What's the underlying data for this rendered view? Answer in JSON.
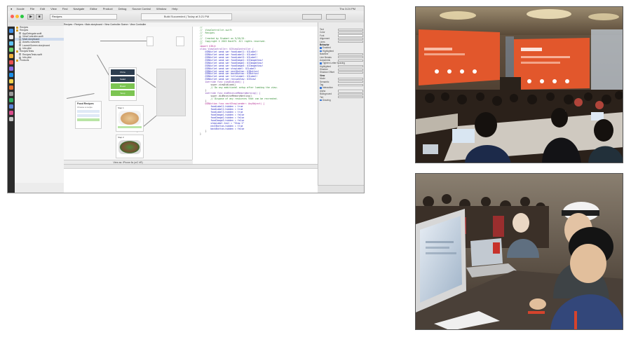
{
  "xcode": {
    "menu": [
      "Xcode",
      "File",
      "Edit",
      "View",
      "Find",
      "Navigate",
      "Editor",
      "Product",
      "Debug",
      "Source Control",
      "Window",
      "Help"
    ],
    "menu_right": "Thu 3:24 PM",
    "status_title": "Build Succeeded | Today at 3:21 PM",
    "scheme": "Recipes",
    "jump_path": "Recipes › Recipes › Main.storyboard › View Controller Scene › View Controller",
    "storyboard": {
      "buttons": [
        "Pizza",
        "Salad",
        "Bread",
        "Soup"
      ],
      "scene_title": "Food Recipes",
      "labels": [
        "Choose a recipe",
        "Step 1",
        "Step 2"
      ],
      "footer": "View as: iPhone 6s (wC hR)"
    },
    "code": [
      {
        "cls": "c",
        "text": "//"
      },
      {
        "cls": "c",
        "text": "//  ViewController.swift"
      },
      {
        "cls": "c",
        "text": "//  Recipes"
      },
      {
        "cls": "c",
        "text": "//"
      },
      {
        "cls": "c",
        "text": "//  Created by Student on 9/26/15."
      },
      {
        "cls": "c",
        "text": "//  Copyright © 2015 HackTX. All rights reserved."
      },
      {
        "cls": "c",
        "text": "//"
      },
      {
        "cls": "p",
        "text": ""
      },
      {
        "cls": "k",
        "text": "import UIKit"
      },
      {
        "cls": "p",
        "text": ""
      },
      {
        "cls": "t",
        "text": "class ViewController: UIViewController {"
      },
      {
        "cls": "p",
        "text": ""
      },
      {
        "cls": "n",
        "text": "    @IBOutlet weak var foodLabel1: UILabel!"
      },
      {
        "cls": "n",
        "text": "    @IBOutlet weak var foodLabel2: UILabel!"
      },
      {
        "cls": "n",
        "text": "    @IBOutlet weak var foodLabel3: UILabel!"
      },
      {
        "cls": "n",
        "text": "    @IBOutlet weak var foodImage1: UIImageView!"
      },
      {
        "cls": "n",
        "text": "    @IBOutlet weak var foodImage2: UIImageView!"
      },
      {
        "cls": "n",
        "text": "    @IBOutlet weak var foodImage3: UIImageView!"
      },
      {
        "cls": "n",
        "text": "    @IBOutlet weak var stepLabel: UILabel!"
      },
      {
        "cls": "n",
        "text": "    @IBOutlet weak var nextButton: UIButton!"
      },
      {
        "cls": "n",
        "text": "    @IBOutlet weak var backButton: UIButton!"
      },
      {
        "cls": "n",
        "text": "    @IBOutlet weak var titleLabel: UILabel!"
      },
      {
        "cls": "n",
        "text": "    @IBOutlet weak var recipeView: UIView!"
      },
      {
        "cls": "p",
        "text": ""
      },
      {
        "cls": "t",
        "text": "    override func viewDidLoad() {"
      },
      {
        "cls": "p",
        "text": "        super.viewDidLoad()"
      },
      {
        "cls": "c",
        "text": "        // Do any additional setup after loading the view."
      },
      {
        "cls": "p",
        "text": "    }"
      },
      {
        "cls": "p",
        "text": ""
      },
      {
        "cls": "t",
        "text": "    override func didReceiveMemoryWarning() {"
      },
      {
        "cls": "p",
        "text": "        super.didReceiveMemoryWarning()"
      },
      {
        "cls": "c",
        "text": "        // Dispose of any resources that can be recreated."
      },
      {
        "cls": "p",
        "text": "    }"
      },
      {
        "cls": "p",
        "text": ""
      },
      {
        "cls": "k",
        "text": "    @IBAction func nextStep(sender: AnyObject) {"
      },
      {
        "cls": "n",
        "text": "        foodLabel1.hidden = true"
      },
      {
        "cls": "n",
        "text": "        foodLabel2.hidden = true"
      },
      {
        "cls": "n",
        "text": "        foodLabel3.hidden = true"
      },
      {
        "cls": "n",
        "text": "        foodImage1.hidden = false"
      },
      {
        "cls": "n",
        "text": "        foodImage2.hidden = false"
      },
      {
        "cls": "n",
        "text": "        foodImage3.hidden = false"
      },
      {
        "cls": "n",
        "text": "        stepLabel.text = \"Step 2\""
      },
      {
        "cls": "n",
        "text": "        nextButton.hidden = true"
      },
      {
        "cls": "n",
        "text": "        backButton.hidden = false"
      },
      {
        "cls": "p",
        "text": "    }"
      },
      {
        "cls": "p",
        "text": "}"
      }
    ],
    "navigator": [
      {
        "label": "Recipes",
        "folder": true,
        "sel": false
      },
      {
        "label": "Recipes",
        "folder": true,
        "sel": false
      },
      {
        "label": "AppDelegate.swift",
        "folder": false,
        "sel": false
      },
      {
        "label": "ViewController.swift",
        "folder": false,
        "sel": false
      },
      {
        "label": "Main.storyboard",
        "folder": false,
        "sel": true
      },
      {
        "label": "Assets.xcassets",
        "folder": false,
        "sel": false
      },
      {
        "label": "LaunchScreen.storyboard",
        "folder": false,
        "sel": false
      },
      {
        "label": "Info.plist",
        "folder": false,
        "sel": false
      },
      {
        "label": "RecipesTests",
        "folder": true,
        "sel": false
      },
      {
        "label": "RecipesTests.swift",
        "folder": false,
        "sel": false
      },
      {
        "label": "Info.plist",
        "folder": false,
        "sel": false
      },
      {
        "label": "Products",
        "folder": true,
        "sel": false
      }
    ],
    "inspector": [
      {
        "label": "Text",
        "type": "field"
      },
      {
        "label": "Color",
        "type": "field"
      },
      {
        "label": "Font",
        "type": "field"
      },
      {
        "label": "Alignment",
        "type": "field"
      },
      {
        "label": "Lines",
        "type": "field"
      },
      {
        "label": "Behavior",
        "type": "hdr"
      },
      {
        "label": "Enabled",
        "type": "chk"
      },
      {
        "label": "Highlighted",
        "type": "chk"
      },
      {
        "label": "Baseline",
        "type": "field"
      },
      {
        "label": "Line Breaks",
        "type": "field"
      },
      {
        "label": "Autoshrink",
        "type": "field"
      },
      {
        "label": "Tighten Letter Spacing",
        "type": "chk"
      },
      {
        "label": "Highlighted",
        "type": "field"
      },
      {
        "label": "Shadow",
        "type": "field"
      },
      {
        "label": "Shadow Offset",
        "type": "field"
      },
      {
        "label": "View",
        "type": "hdr"
      },
      {
        "label": "Mode",
        "type": "field"
      },
      {
        "label": "Semantic",
        "type": "field"
      },
      {
        "label": "Tag",
        "type": "field"
      },
      {
        "label": "Interaction",
        "type": "chk"
      },
      {
        "label": "Alpha",
        "type": "field"
      },
      {
        "label": "Background",
        "type": "field"
      },
      {
        "label": "Tint",
        "type": "field"
      },
      {
        "label": "Drawing",
        "type": "chk"
      }
    ]
  },
  "colors": {
    "slide_orange": "#e2572c",
    "button_green": "#7cc552",
    "button_dark": "#2d3e50"
  }
}
